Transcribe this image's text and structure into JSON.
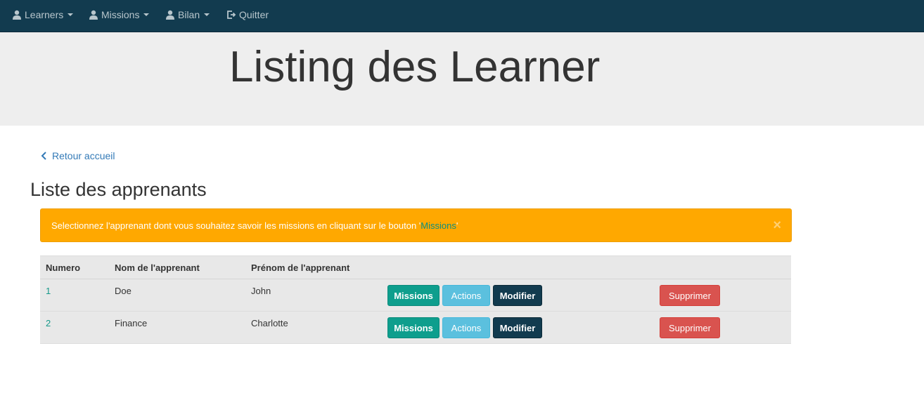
{
  "navbar": {
    "items": [
      {
        "label": "Learners",
        "icon": "user-icon",
        "dropdown": true
      },
      {
        "label": "Missions",
        "icon": "user-icon",
        "dropdown": true
      },
      {
        "label": "Bilan",
        "icon": "user-icon",
        "dropdown": true
      },
      {
        "label": "Quitter",
        "icon": "logout-icon",
        "dropdown": false
      }
    ]
  },
  "jumbotron": {
    "title": "Listing des Learner"
  },
  "back_link": {
    "label": "Retour accueil"
  },
  "section_title": "Liste des apprenants",
  "alert": {
    "text_before": "Selectionnez l'apprenant dont vous souhaitez savoir les missions en cliquant sur le bouton '",
    "link_text": "Missions",
    "text_after": "'",
    "close": "×"
  },
  "table": {
    "headers": [
      "Numero",
      "Nom de l'apprenant",
      "Prénom de l'apprenant"
    ],
    "rows": [
      {
        "numero": "1",
        "nom": "Doe",
        "prenom": "John"
      },
      {
        "numero": "2",
        "nom": "Finance",
        "prenom": "Charlotte"
      }
    ],
    "buttons": {
      "missions": "Missions",
      "actions": "Actions",
      "modifier": "Modifier",
      "supprimer": "Supprimer"
    }
  },
  "colors": {
    "navbar": "#123b4f",
    "jumbotron": "#eeeeee",
    "alert": "#ffa800",
    "missions_button": "#0e9e8d",
    "actions_button": "#5bc0de",
    "modifier_button": "#123b4f",
    "supprimer_button": "#d9534f",
    "link": "#337ab7"
  }
}
